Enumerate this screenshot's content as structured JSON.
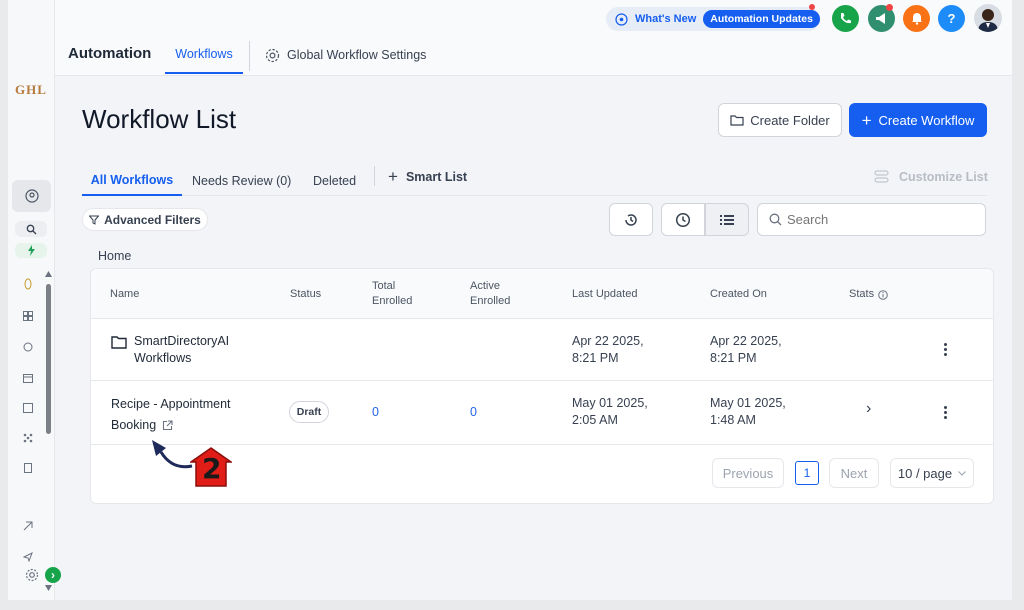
{
  "header": {
    "section_title": "Automation",
    "tabs": [
      {
        "label": "Workflows",
        "active": true
      },
      {
        "label": "Global Workflow Settings",
        "active": false
      }
    ],
    "whats_new": "What's New",
    "automation_updates": "Automation Updates",
    "help": "?"
  },
  "sidebar": {
    "logo": "GHL",
    "settings_badge": "›"
  },
  "page": {
    "title": "Workflow List",
    "create_folder": "Create Folder",
    "create_workflow": "Create Workflow",
    "create_workflow_plus": "+"
  },
  "list_tabs": {
    "items": [
      "All Workflows",
      "Needs Review (0)",
      "Deleted"
    ],
    "smart_list": "Smart List",
    "smart_list_plus": "+",
    "customize": "Customize List"
  },
  "filters": {
    "advanced": "Advanced Filters",
    "search_placeholder": "Search"
  },
  "breadcrumb": "Home",
  "table": {
    "columns": {
      "name": "Name",
      "status": "Status",
      "total_enrolled_1": "Total",
      "total_enrolled_2": "Enrolled",
      "active_enrolled_1": "Active",
      "active_enrolled_2": "Enrolled",
      "last_updated": "Last Updated",
      "created_on": "Created On",
      "stats": "Stats"
    },
    "rows": [
      {
        "name_line1": "SmartDirectoryAI",
        "name_line2": "Workflows",
        "last_updated_1": "Apr 22 2025,",
        "last_updated_2": "8:21 PM",
        "created_1": "Apr 22 2025,",
        "created_2": "8:21 PM"
      },
      {
        "name_line1": "Recipe - Appointment",
        "name_line2": "Booking",
        "status": "Draft",
        "total": "0",
        "active": "0",
        "last_updated_1": "May 01 2025,",
        "last_updated_2": "2:05 AM",
        "created_1": "May 01 2025,",
        "created_2": "1:48 AM",
        "arrow": "›"
      }
    ]
  },
  "pagination": {
    "previous": "Previous",
    "page": "1",
    "next": "Next",
    "per_page": "10 / page"
  },
  "annotation": {
    "step": "2"
  },
  "colors": {
    "primary": "#155eef",
    "phone": "#17a34a",
    "megaphone": "#2f8f6e",
    "bell": "#f97316",
    "help": "#1d8cf8",
    "annotation": "#e11d17"
  }
}
